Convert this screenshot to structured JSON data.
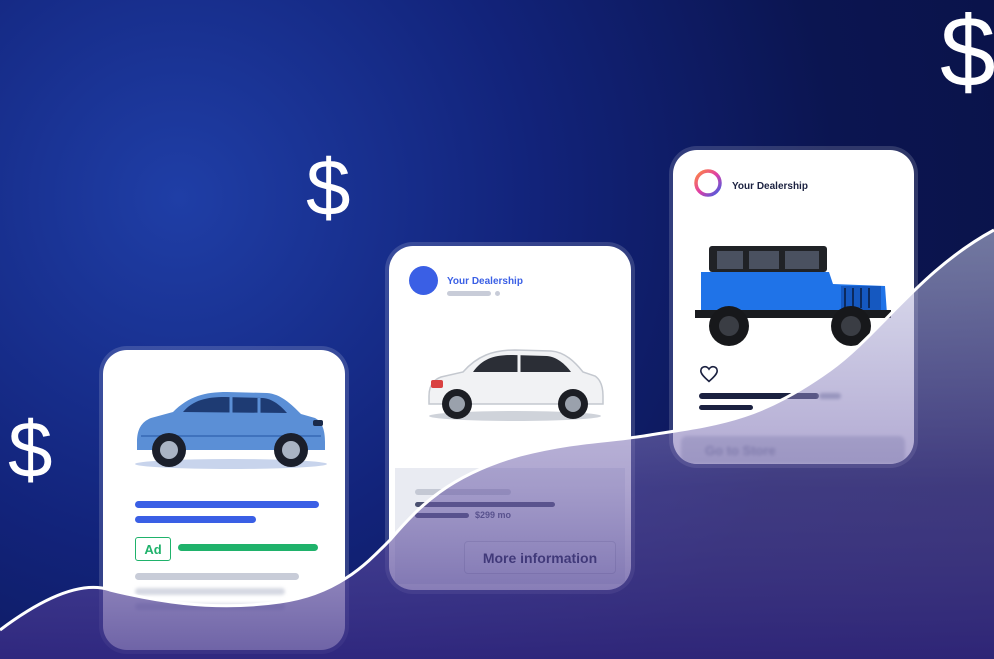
{
  "decorations": {
    "dollar_symbol": "$"
  },
  "card_left": {
    "car": "blue-suv",
    "ad_badge": "Ad",
    "colors": {
      "primary_bar": "#3a5fe5",
      "ad_bar": "#1fb26b",
      "gray_bar": "#c8ccd8"
    }
  },
  "card_middle": {
    "dealer_name": "Your Dealership",
    "car": "white-hatchback",
    "price": "$299 mo",
    "button_label": "More information",
    "colors": {
      "avatar": "#3a5fe5",
      "name": "#3a5fe5",
      "panel": "#e9ebf2"
    }
  },
  "card_right": {
    "dealer_name": "Your Dealership",
    "car": "blue-jeep",
    "heart_icon": "heart-outline-icon",
    "button_label": "Go to Store",
    "colors": {
      "name": "#1b2140",
      "bar": "#1b2140"
    }
  }
}
